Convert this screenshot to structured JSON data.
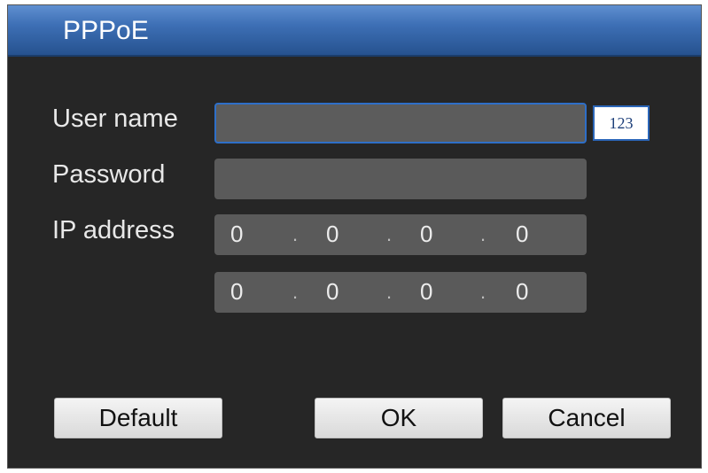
{
  "dialog": {
    "title": "PPPoE"
  },
  "form": {
    "username_label": "User name",
    "username_value": "",
    "keyboard_toggle": "123",
    "password_label": "Password",
    "password_value": "",
    "ip_label": "IP address",
    "ip_address": [
      "0",
      "0",
      "0",
      "0"
    ],
    "ip_address_2": [
      "0",
      "0",
      "0",
      "0"
    ]
  },
  "buttons": {
    "default": "Default",
    "ok": "OK",
    "cancel": "Cancel"
  },
  "colors": {
    "titlebar": "#3d6fb5",
    "background": "#262626",
    "field": "#5a5a5a",
    "accent": "#2e6fc8"
  }
}
